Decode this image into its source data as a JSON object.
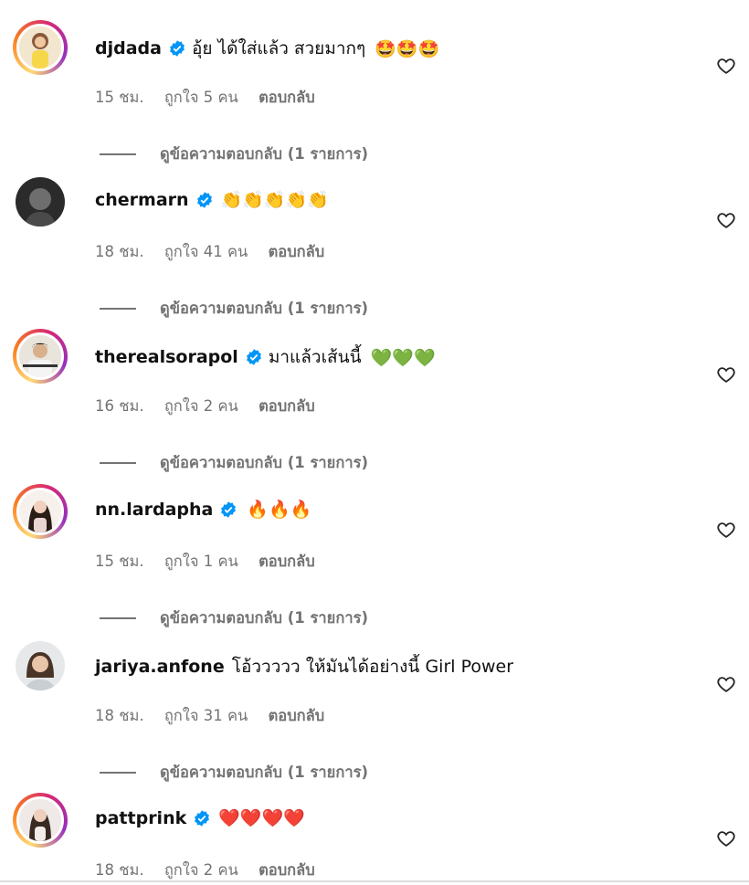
{
  "comments": [
    {
      "username": "djdada",
      "text": "อุ้ย ได้ใส่แล้ว สวยมากๆ",
      "emoji": "🤩🤩🤩",
      "time": "15 ชม.",
      "likes": "ถูกใจ 5 คน",
      "reply": "ตอบกลับ",
      "view_replies": "ดูข้อความตอบกลับ (1 รายการ)"
    },
    {
      "username": "chermarn",
      "text": "",
      "emoji": "👏👏👏👏👏",
      "time": "18 ชม.",
      "likes": "ถูกใจ 41 คน",
      "reply": "ตอบกลับ",
      "view_replies": "ดูข้อความตอบกลับ (1 รายการ)"
    },
    {
      "username": "therealsorapol",
      "text": "มาแล้วเส้นนี้",
      "emoji": "💚💚💚",
      "time": "16 ชม.",
      "likes": "ถูกใจ 2 คน",
      "reply": "ตอบกลับ",
      "view_replies": "ดูข้อความตอบกลับ (1 รายการ)"
    },
    {
      "username": "nn.lardapha",
      "text": "",
      "emoji": "🔥🔥🔥",
      "time": "15 ชม.",
      "likes": "ถูกใจ 1 คน",
      "reply": "ตอบกลับ",
      "view_replies": "ดูข้อความตอบกลับ (1 รายการ)"
    },
    {
      "username": "jariya.anfone",
      "text": "โอ้ววววว ให้มันได้อย่างนี้ Girl Power",
      "emoji": "",
      "time": "18 ชม.",
      "likes": "ถูกใจ 31 คน",
      "reply": "ตอบกลับ",
      "view_replies": "ดูข้อความตอบกลับ (1 รายการ)"
    },
    {
      "username": "pattprink",
      "text": "",
      "emoji": "❤️❤️❤️❤️",
      "time": "18 ชม.",
      "likes": "ถูกใจ 2 คน",
      "reply": "ตอบกลับ",
      "view_replies": ""
    }
  ],
  "icons": {
    "verified": "verified-badge-icon",
    "like": "heart-outline-icon"
  },
  "colors": {
    "verified": "#0095f6",
    "meta": "#737373",
    "ring_start": "#feda75",
    "ring_end": "#962fbf"
  }
}
